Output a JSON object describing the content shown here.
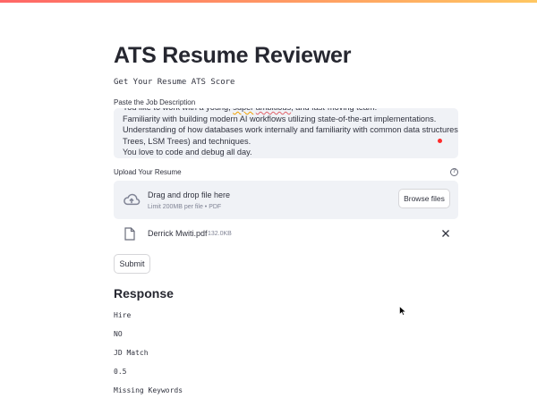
{
  "app": {
    "title": "ATS Resume Reviewer",
    "subtitle": "Get Your Resume ATS Score"
  },
  "job_description": {
    "label": "Paste the Job Description",
    "lines": [
      "You like to work with a young, super ambitious, and fast-moving team.",
      "Familiarity with building modern AI workflows utilizing state-of-the-art implementations.",
      "Understanding of how databases work internally and familiarity with common data structures (B-",
      "Trees, LSM Trees) and techniques.",
      "You love to code and debug all day."
    ]
  },
  "upload": {
    "label": "Upload Your Resume",
    "help_icon": "question-circle-icon",
    "dropzone_title": "Drag and drop file here",
    "dropzone_limit": "Limit 200MB per file • PDF",
    "browse_label": "Browse files",
    "icon": "cloud-upload-icon"
  },
  "uploaded_file": {
    "name": "Derrick Mwiti.pdf",
    "size": "132.0KB",
    "icon": "file-icon",
    "remove_icon": "close-icon"
  },
  "submit_label": "Submit",
  "response": {
    "heading": "Response",
    "items": [
      "Hire",
      "NO",
      "JD Match",
      "0.5",
      "Missing Keywords"
    ]
  },
  "colors": {
    "accent_red": "#ff4b4b",
    "field_bg": "#f0f2f6",
    "text": "#31333f"
  }
}
